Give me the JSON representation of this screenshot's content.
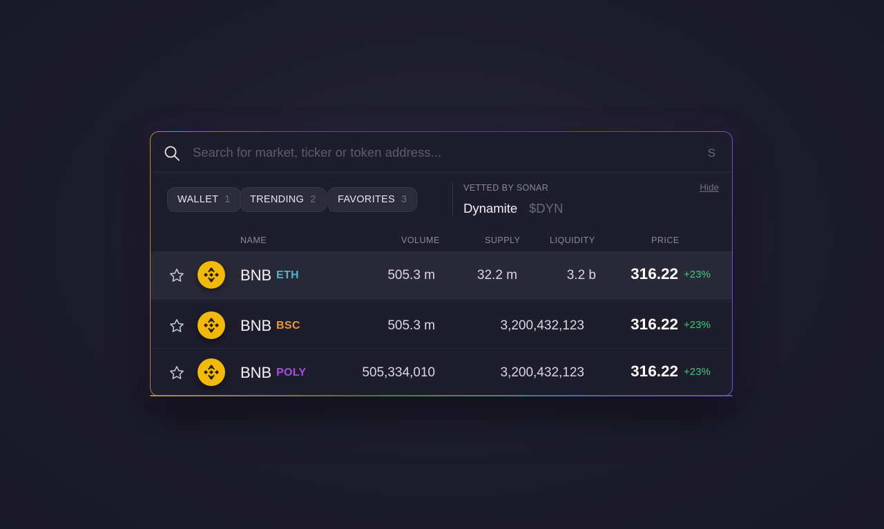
{
  "search": {
    "placeholder": "Search for market, ticker or token address...",
    "shortcut": "S"
  },
  "tabs": [
    {
      "label": "WALLET",
      "count": "1"
    },
    {
      "label": "TRENDING",
      "count": "2"
    },
    {
      "label": "FAVORITES",
      "count": "3"
    }
  ],
  "vetted": {
    "label": "VETTED BY SONAR",
    "name": "Dynamite",
    "ticker": "$DYN",
    "hide_label": "Hide"
  },
  "table": {
    "headers": {
      "name": "NAME",
      "volume": "VOLUME",
      "supply": "SUPPLY",
      "liquidity": "LIQUIDITY",
      "price": "PRICE"
    },
    "rows": [
      {
        "name": "BNB",
        "chain": "ETH",
        "chain_color": "#4fb8c9",
        "volume": "505.3 m",
        "supply": "32.2 m",
        "liquidity": "3.2 b",
        "price": "316.22",
        "change": "+23%",
        "icon": "bnb-icon"
      },
      {
        "name": "BNB",
        "chain": "BSC",
        "chain_color": "#e39a3e",
        "volume": "505.3 m",
        "supply": "3,200,432,123",
        "price": "316.22",
        "change": "+23%",
        "icon": "bnb-icon"
      },
      {
        "name": "BNB",
        "chain": "POLY",
        "chain_color": "#a64ee0",
        "volume": "505,334,010",
        "supply": "3,200,432,123",
        "price": "316.22",
        "change": "+23%",
        "icon": "bnb-icon"
      }
    ]
  },
  "colors": {
    "accent_positive": "#3ccf7a",
    "bnb_yellow": "#f0b90b"
  }
}
